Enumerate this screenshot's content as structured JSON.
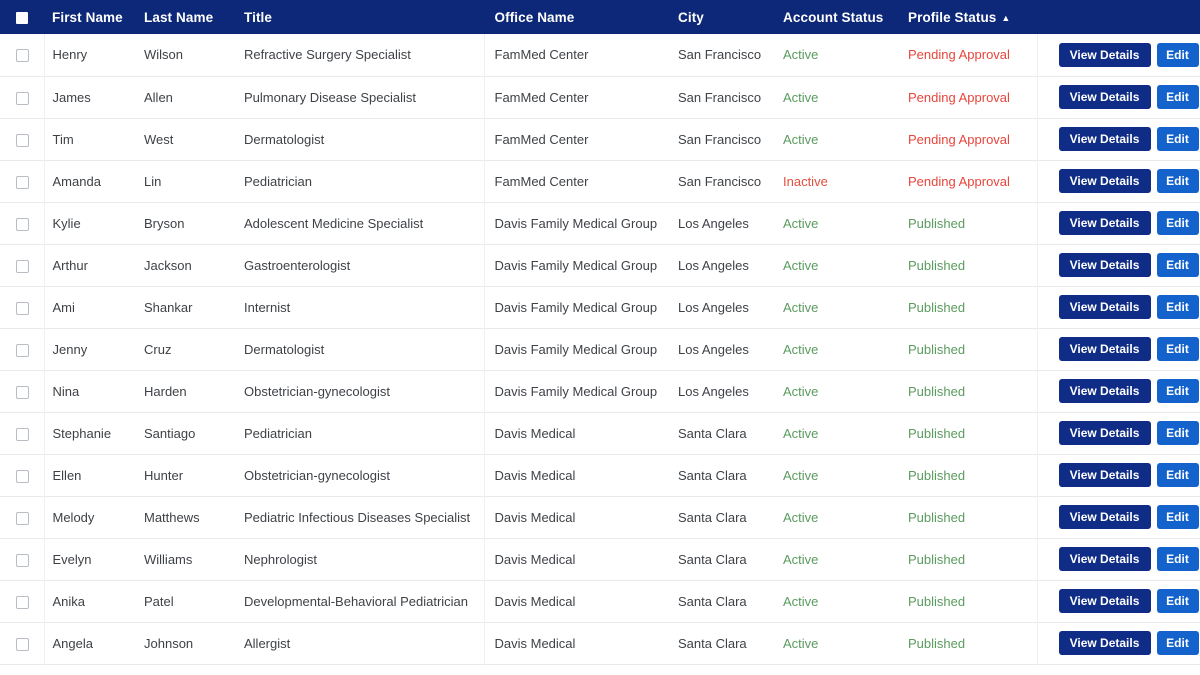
{
  "table": {
    "sort_column": "Profile Status",
    "sort_direction_icon": "▲",
    "columns": {
      "select_all": "",
      "first_name": "First Name",
      "last_name": "Last Name",
      "title": "Title",
      "office_name": "Office Name",
      "city": "City",
      "account_status": "Account Status",
      "profile_status": "Profile Status",
      "actions": ""
    },
    "buttons": {
      "view_details": "View Details",
      "edit": "Edit"
    },
    "colors": {
      "header_bg": "#0d2878",
      "active": "#5a9b5e",
      "inactive": "#e2503f",
      "pending": "#e8453c",
      "published": "#5a9b5e",
      "view_button": "#0f2d86",
      "edit_button": "#1463cc"
    },
    "rows": [
      {
        "first_name": "Henry",
        "last_name": "Wilson",
        "title": "Refractive Surgery Specialist",
        "office_name": "FamMed Center",
        "city": "San Francisco",
        "account_status": "Active",
        "account_status_kind": "active",
        "profile_status": "Pending Approval",
        "profile_status_kind": "pending"
      },
      {
        "first_name": "James",
        "last_name": "Allen",
        "title": "Pulmonary Disease Specialist",
        "office_name": "FamMed Center",
        "city": "San Francisco",
        "account_status": "Active",
        "account_status_kind": "active",
        "profile_status": "Pending Approval",
        "profile_status_kind": "pending"
      },
      {
        "first_name": "Tim",
        "last_name": "West",
        "title": "Dermatologist",
        "office_name": "FamMed Center",
        "city": "San Francisco",
        "account_status": "Active",
        "account_status_kind": "active",
        "profile_status": "Pending Approval",
        "profile_status_kind": "pending"
      },
      {
        "first_name": "Amanda",
        "last_name": "Lin",
        "title": "Pediatrician",
        "office_name": "FamMed Center",
        "city": "San Francisco",
        "account_status": "Inactive",
        "account_status_kind": "inactive",
        "profile_status": "Pending Approval",
        "profile_status_kind": "pending"
      },
      {
        "first_name": "Kylie",
        "last_name": "Bryson",
        "title": "Adolescent Medicine Specialist",
        "office_name": "Davis Family Medical Group",
        "city": "Los Angeles",
        "account_status": "Active",
        "account_status_kind": "active",
        "profile_status": "Published",
        "profile_status_kind": "published"
      },
      {
        "first_name": "Arthur",
        "last_name": "Jackson",
        "title": "Gastroenterologist",
        "office_name": "Davis Family Medical Group",
        "city": "Los Angeles",
        "account_status": "Active",
        "account_status_kind": "active",
        "profile_status": "Published",
        "profile_status_kind": "published"
      },
      {
        "first_name": "Ami",
        "last_name": "Shankar",
        "title": "Internist",
        "office_name": "Davis Family Medical Group",
        "city": "Los Angeles",
        "account_status": "Active",
        "account_status_kind": "active",
        "profile_status": "Published",
        "profile_status_kind": "published"
      },
      {
        "first_name": "Jenny",
        "last_name": "Cruz",
        "title": "Dermatologist",
        "office_name": "Davis Family Medical Group",
        "city": "Los Angeles",
        "account_status": "Active",
        "account_status_kind": "active",
        "profile_status": "Published",
        "profile_status_kind": "published"
      },
      {
        "first_name": "Nina",
        "last_name": "Harden",
        "title": "Obstetrician-gynecologist",
        "office_name": "Davis Family Medical Group",
        "city": "Los Angeles",
        "account_status": "Active",
        "account_status_kind": "active",
        "profile_status": "Published",
        "profile_status_kind": "published"
      },
      {
        "first_name": "Stephanie",
        "last_name": "Santiago",
        "title": "Pediatrician",
        "office_name": "Davis Medical",
        "city": "Santa Clara",
        "account_status": "Active",
        "account_status_kind": "active",
        "profile_status": "Published",
        "profile_status_kind": "published"
      },
      {
        "first_name": "Ellen",
        "last_name": "Hunter",
        "title": "Obstetrician-gynecologist",
        "office_name": "Davis Medical",
        "city": "Santa Clara",
        "account_status": "Active",
        "account_status_kind": "active",
        "profile_status": "Published",
        "profile_status_kind": "published"
      },
      {
        "first_name": "Melody",
        "last_name": "Matthews",
        "title": "Pediatric Infectious Diseases Specialist",
        "office_name": "Davis Medical",
        "city": "Santa Clara",
        "account_status": "Active",
        "account_status_kind": "active",
        "profile_status": "Published",
        "profile_status_kind": "published"
      },
      {
        "first_name": "Evelyn",
        "last_name": "Williams",
        "title": "Nephrologist",
        "office_name": "Davis Medical",
        "city": "Santa Clara",
        "account_status": "Active",
        "account_status_kind": "active",
        "profile_status": "Published",
        "profile_status_kind": "published"
      },
      {
        "first_name": "Anika",
        "last_name": "Patel",
        "title": "Developmental-Behavioral Pediatrician",
        "office_name": "Davis Medical",
        "city": "Santa Clara",
        "account_status": "Active",
        "account_status_kind": "active",
        "profile_status": "Published",
        "profile_status_kind": "published"
      },
      {
        "first_name": "Angela",
        "last_name": "Johnson",
        "title": "Allergist",
        "office_name": "Davis Medical",
        "city": "Santa Clara",
        "account_status": "Active",
        "account_status_kind": "active",
        "profile_status": "Published",
        "profile_status_kind": "published"
      }
    ]
  }
}
